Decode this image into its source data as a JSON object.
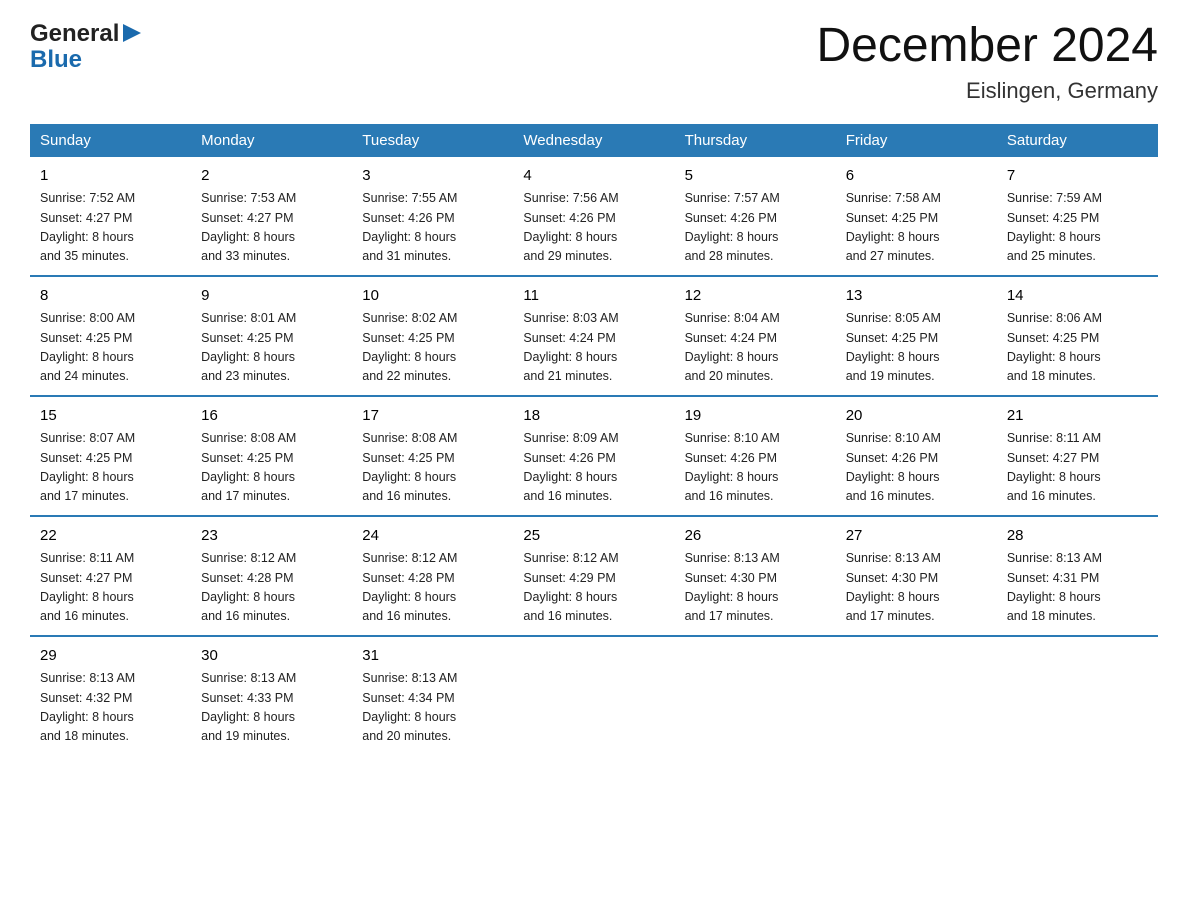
{
  "logo": {
    "line1": "General",
    "line2": "Blue"
  },
  "title": {
    "month_year": "December 2024",
    "location": "Eislingen, Germany"
  },
  "days_of_week": [
    "Sunday",
    "Monday",
    "Tuesday",
    "Wednesday",
    "Thursday",
    "Friday",
    "Saturday"
  ],
  "weeks": [
    [
      {
        "day": "1",
        "sunrise": "7:52 AM",
        "sunset": "4:27 PM",
        "daylight": "8 hours and 35 minutes."
      },
      {
        "day": "2",
        "sunrise": "7:53 AM",
        "sunset": "4:27 PM",
        "daylight": "8 hours and 33 minutes."
      },
      {
        "day": "3",
        "sunrise": "7:55 AM",
        "sunset": "4:26 PM",
        "daylight": "8 hours and 31 minutes."
      },
      {
        "day": "4",
        "sunrise": "7:56 AM",
        "sunset": "4:26 PM",
        "daylight": "8 hours and 29 minutes."
      },
      {
        "day": "5",
        "sunrise": "7:57 AM",
        "sunset": "4:26 PM",
        "daylight": "8 hours and 28 minutes."
      },
      {
        "day": "6",
        "sunrise": "7:58 AM",
        "sunset": "4:25 PM",
        "daylight": "8 hours and 27 minutes."
      },
      {
        "day": "7",
        "sunrise": "7:59 AM",
        "sunset": "4:25 PM",
        "daylight": "8 hours and 25 minutes."
      }
    ],
    [
      {
        "day": "8",
        "sunrise": "8:00 AM",
        "sunset": "4:25 PM",
        "daylight": "8 hours and 24 minutes."
      },
      {
        "day": "9",
        "sunrise": "8:01 AM",
        "sunset": "4:25 PM",
        "daylight": "8 hours and 23 minutes."
      },
      {
        "day": "10",
        "sunrise": "8:02 AM",
        "sunset": "4:25 PM",
        "daylight": "8 hours and 22 minutes."
      },
      {
        "day": "11",
        "sunrise": "8:03 AM",
        "sunset": "4:24 PM",
        "daylight": "8 hours and 21 minutes."
      },
      {
        "day": "12",
        "sunrise": "8:04 AM",
        "sunset": "4:24 PM",
        "daylight": "8 hours and 20 minutes."
      },
      {
        "day": "13",
        "sunrise": "8:05 AM",
        "sunset": "4:25 PM",
        "daylight": "8 hours and 19 minutes."
      },
      {
        "day": "14",
        "sunrise": "8:06 AM",
        "sunset": "4:25 PM",
        "daylight": "8 hours and 18 minutes."
      }
    ],
    [
      {
        "day": "15",
        "sunrise": "8:07 AM",
        "sunset": "4:25 PM",
        "daylight": "8 hours and 17 minutes."
      },
      {
        "day": "16",
        "sunrise": "8:08 AM",
        "sunset": "4:25 PM",
        "daylight": "8 hours and 17 minutes."
      },
      {
        "day": "17",
        "sunrise": "8:08 AM",
        "sunset": "4:25 PM",
        "daylight": "8 hours and 16 minutes."
      },
      {
        "day": "18",
        "sunrise": "8:09 AM",
        "sunset": "4:26 PM",
        "daylight": "8 hours and 16 minutes."
      },
      {
        "day": "19",
        "sunrise": "8:10 AM",
        "sunset": "4:26 PM",
        "daylight": "8 hours and 16 minutes."
      },
      {
        "day": "20",
        "sunrise": "8:10 AM",
        "sunset": "4:26 PM",
        "daylight": "8 hours and 16 minutes."
      },
      {
        "day": "21",
        "sunrise": "8:11 AM",
        "sunset": "4:27 PM",
        "daylight": "8 hours and 16 minutes."
      }
    ],
    [
      {
        "day": "22",
        "sunrise": "8:11 AM",
        "sunset": "4:27 PM",
        "daylight": "8 hours and 16 minutes."
      },
      {
        "day": "23",
        "sunrise": "8:12 AM",
        "sunset": "4:28 PM",
        "daylight": "8 hours and 16 minutes."
      },
      {
        "day": "24",
        "sunrise": "8:12 AM",
        "sunset": "4:28 PM",
        "daylight": "8 hours and 16 minutes."
      },
      {
        "day": "25",
        "sunrise": "8:12 AM",
        "sunset": "4:29 PM",
        "daylight": "8 hours and 16 minutes."
      },
      {
        "day": "26",
        "sunrise": "8:13 AM",
        "sunset": "4:30 PM",
        "daylight": "8 hours and 17 minutes."
      },
      {
        "day": "27",
        "sunrise": "8:13 AM",
        "sunset": "4:30 PM",
        "daylight": "8 hours and 17 minutes."
      },
      {
        "day": "28",
        "sunrise": "8:13 AM",
        "sunset": "4:31 PM",
        "daylight": "8 hours and 18 minutes."
      }
    ],
    [
      {
        "day": "29",
        "sunrise": "8:13 AM",
        "sunset": "4:32 PM",
        "daylight": "8 hours and 18 minutes."
      },
      {
        "day": "30",
        "sunrise": "8:13 AM",
        "sunset": "4:33 PM",
        "daylight": "8 hours and 19 minutes."
      },
      {
        "day": "31",
        "sunrise": "8:13 AM",
        "sunset": "4:34 PM",
        "daylight": "8 hours and 20 minutes."
      },
      null,
      null,
      null,
      null
    ]
  ],
  "labels": {
    "sunrise": "Sunrise:",
    "sunset": "Sunset:",
    "daylight": "Daylight:"
  }
}
